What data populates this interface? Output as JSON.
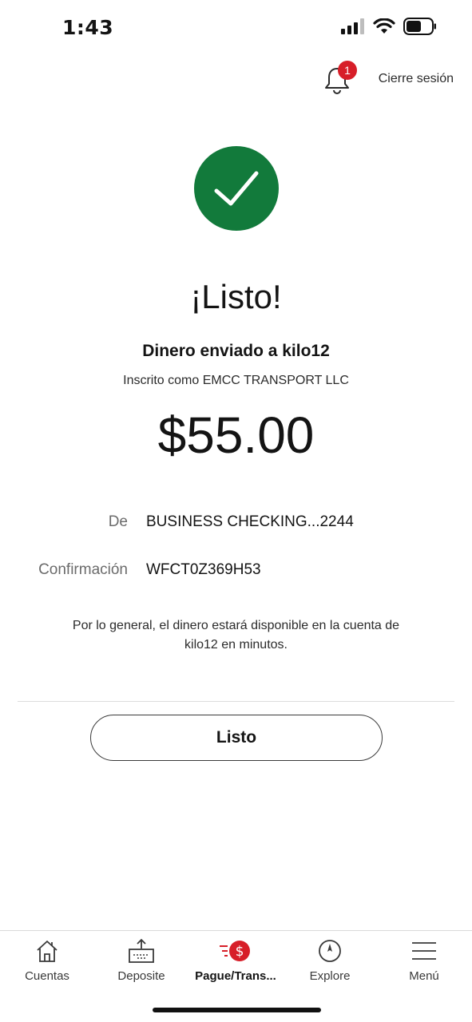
{
  "status_bar": {
    "time": "1:43"
  },
  "header": {
    "notification_count": "1",
    "logout_label": "Cierre sesión"
  },
  "confirmation": {
    "title": "¡Listo!",
    "subtitle": "Dinero enviado a kilo12",
    "registered_as": "Inscrito como EMCC TRANSPORT LLC",
    "amount": "$55.00",
    "from_label": "De",
    "from_value": "BUSINESS CHECKING...2244",
    "confirmation_label": "Confirmación",
    "confirmation_value": "WFCT0Z369H53",
    "note": "Por lo general, el dinero estará disponible en la cuenta de kilo12 en minutos.",
    "done_label": "Listo"
  },
  "colors": {
    "success": "#127a3b",
    "brand_red": "#d71e28"
  },
  "bottom_nav": {
    "items": [
      {
        "label": "Cuentas",
        "icon": "home-icon",
        "active": false
      },
      {
        "label": "Deposite",
        "icon": "deposit-icon",
        "active": false
      },
      {
        "label": "Pague/Trans...",
        "icon": "pay-transfer-icon",
        "active": true
      },
      {
        "label": "Explore",
        "icon": "compass-icon",
        "active": false
      },
      {
        "label": "Menú",
        "icon": "menu-icon",
        "active": false
      }
    ]
  }
}
